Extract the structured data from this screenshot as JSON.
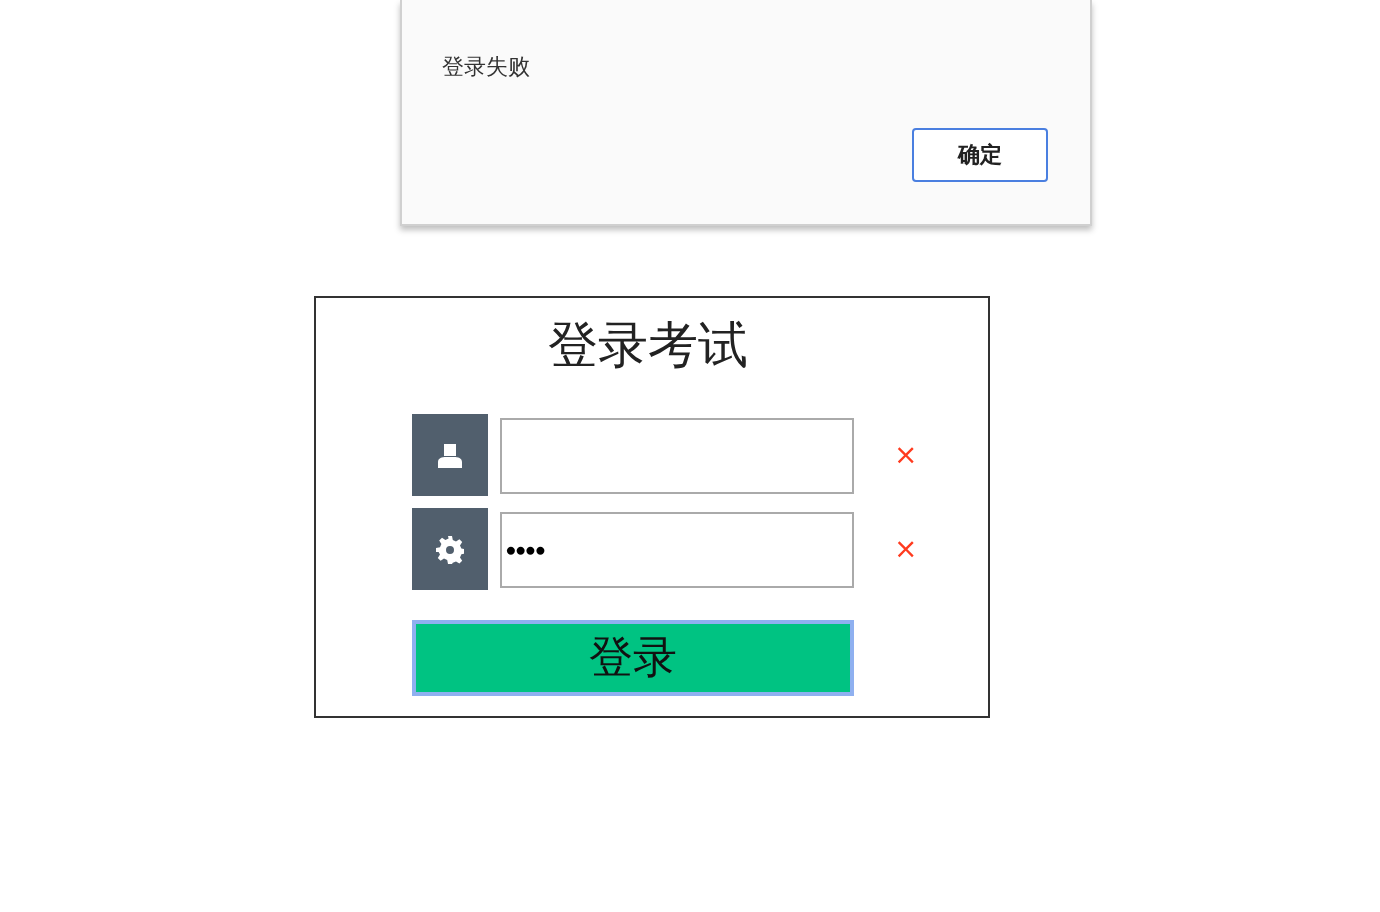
{
  "alert": {
    "message": "登录失败",
    "button": "确定"
  },
  "form": {
    "title": "登录考试",
    "fields": [
      {
        "kind": "text",
        "error": "×"
      },
      {
        "kind": "password",
        "value": "••••",
        "error": "×"
      }
    ],
    "submit": "登录"
  }
}
